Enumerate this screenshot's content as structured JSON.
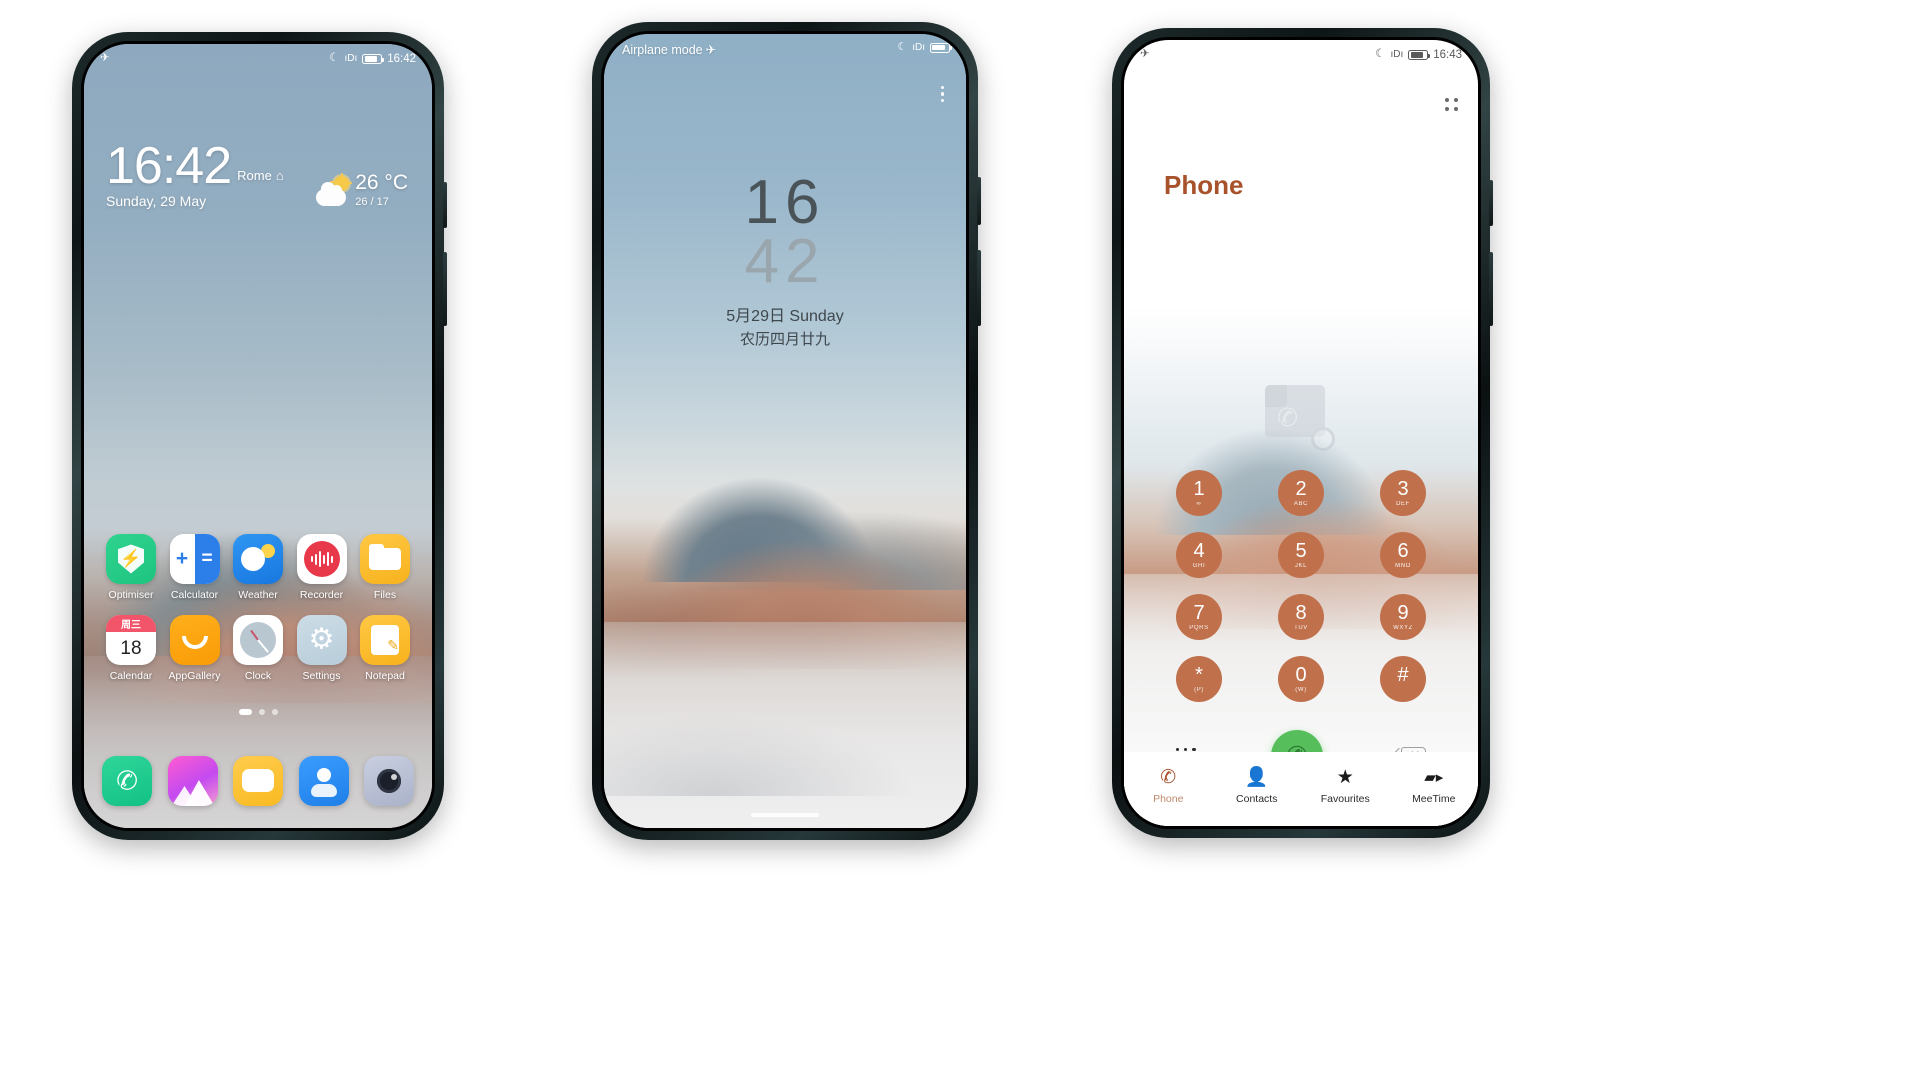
{
  "phone1": {
    "name": "home-screen",
    "status": {
      "airplane_icon": "airplane-icon",
      "moon_icon": "do-not-disturb-icon",
      "vibrate_icon": "vibrate-icon",
      "battery_icon": "battery-icon",
      "time": "16:42"
    },
    "clock": {
      "time": "16:42",
      "city": "Rome",
      "home_icon": "home-icon",
      "date": "Sunday, 29 May"
    },
    "weather": {
      "icon": "partly-cloudy-icon",
      "temp": "26 °C",
      "range": "26 / 17"
    },
    "apps_row1": [
      {
        "label": "Optimiser",
        "icon": "optimiser-icon"
      },
      {
        "label": "Calculator",
        "icon": "calculator-icon"
      },
      {
        "label": "Weather",
        "icon": "weather-icon"
      },
      {
        "label": "Recorder",
        "icon": "recorder-icon"
      },
      {
        "label": "Files",
        "icon": "files-icon"
      }
    ],
    "apps_row2": [
      {
        "label": "Calendar",
        "icon": "calendar-icon",
        "weekday": "周三",
        "day": "18"
      },
      {
        "label": "AppGallery",
        "icon": "appgallery-icon"
      },
      {
        "label": "Clock",
        "icon": "clock-icon"
      },
      {
        "label": "Settings",
        "icon": "settings-icon",
        "glyph": "⚙"
      },
      {
        "label": "Notepad",
        "icon": "notepad-icon",
        "glyph": "✎"
      }
    ],
    "dock": [
      {
        "name": "phone-app",
        "icon": "phone-handset-icon",
        "glyph": "✆"
      },
      {
        "name": "gallery-app",
        "icon": "gallery-icon"
      },
      {
        "name": "messages-app",
        "icon": "messages-bubble-icon"
      },
      {
        "name": "contacts-app",
        "icon": "contacts-person-icon"
      },
      {
        "name": "camera-app",
        "icon": "camera-lens-icon"
      }
    ],
    "page_dots": 3,
    "active_dot": 0
  },
  "phone2": {
    "name": "lock-screen",
    "airplane_label": "Airplane mode",
    "airplane_icon": "airplane-icon",
    "status": {
      "moon_icon": "do-not-disturb-icon",
      "vibrate_icon": "vibrate-icon",
      "battery_icon": "battery-icon"
    },
    "menu_icon": "kebab-menu-icon",
    "clock": {
      "hours": "16",
      "minutes": "42",
      "date_line1": "5月29日 Sunday",
      "date_line2": "农历四月廿九"
    },
    "home_indicator": "home-indicator"
  },
  "phone3": {
    "name": "dialer-screen",
    "status": {
      "airplane_icon": "airplane-icon",
      "moon_icon": "do-not-disturb-icon",
      "vibrate_icon": "vibrate-icon",
      "battery_icon": "battery-icon",
      "time": "16:43"
    },
    "title": "Phone",
    "grid_icon": "app-grid-icon",
    "placeholder_icon": "call-log-empty-icon",
    "keys": [
      {
        "num": "1",
        "letters": "∞"
      },
      {
        "num": "2",
        "letters": "ABC"
      },
      {
        "num": "3",
        "letters": "DEF"
      },
      {
        "num": "4",
        "letters": "GHI"
      },
      {
        "num": "5",
        "letters": "JKL"
      },
      {
        "num": "6",
        "letters": "MNO"
      },
      {
        "num": "7",
        "letters": "PQRS"
      },
      {
        "num": "8",
        "letters": "TUV"
      },
      {
        "num": "9",
        "letters": "WXYZ"
      },
      {
        "num": "*",
        "letters": "(P)"
      },
      {
        "num": "0",
        "letters": "(W)"
      },
      {
        "num": "#",
        "letters": ""
      }
    ],
    "actions": {
      "keypad_icon": "keypad-icon",
      "call_icon": "call-handset-icon",
      "call_glyph": "✆",
      "delete_icon": "backspace-icon"
    },
    "nav": [
      {
        "label": "Phone",
        "icon": "phone-handset-icon",
        "glyph": "✆",
        "active": true
      },
      {
        "label": "Contacts",
        "icon": "contacts-person-icon",
        "glyph": "👤",
        "active": false
      },
      {
        "label": "Favourites",
        "icon": "star-icon",
        "glyph": "★",
        "active": false
      },
      {
        "label": "MeeTime",
        "icon": "video-camera-icon",
        "glyph": "■",
        "active": false
      }
    ]
  },
  "colors": {
    "accent": "#a8522c",
    "key": "#c0714c",
    "call": "#56bf5c"
  }
}
